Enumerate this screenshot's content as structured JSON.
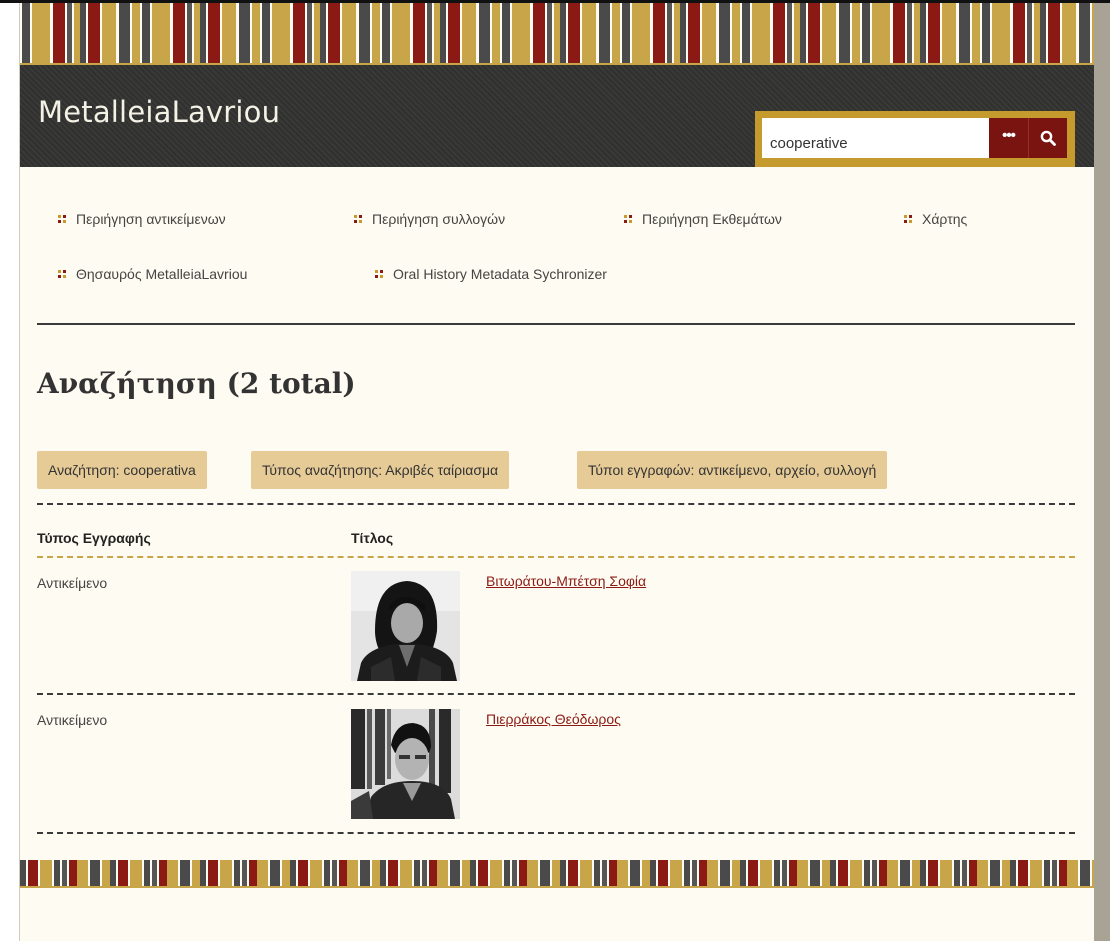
{
  "site": {
    "title": "MetalleiaLavriou"
  },
  "search": {
    "value": "cooperative",
    "advanced_label": "•••"
  },
  "nav": {
    "items": [
      {
        "label": "Περιήγηση αντικείμενων"
      },
      {
        "label": "Περιήγηση συλλογών"
      },
      {
        "label": "Περιήγηση Εκθεμάτων"
      },
      {
        "label": "Χάρτης"
      },
      {
        "label": "Θησαυρός MetalleiaLavriou"
      },
      {
        "label": "Oral History Metadata Sychronizer"
      }
    ]
  },
  "results": {
    "title": "Αναζήτηση",
    "count": "(2 total)",
    "filters": [
      "Αναζήτηση: cooperativa",
      "Τύπος αναζήτησης: Ακριβές ταίριασμα",
      "Τύποι εγγραφών: αντικείμενο, αρχείο, συλλογή"
    ],
    "columns": {
      "type": "Τύπος Εγγραφής",
      "title": "Τίτλος"
    },
    "rows": [
      {
        "type": "Αντικείμενο",
        "title": "Βιτωράτου-Μπέτση Σοφία"
      },
      {
        "type": "Αντικείμενο",
        "title": "Πιερράκος Θεόδωρος"
      }
    ]
  },
  "colors": {
    "gold": "#c69b2e",
    "maroon": "#7a1411",
    "header_bg": "#333331",
    "page_bg": "#fefcf2",
    "filter_bg": "#e6cb97"
  }
}
